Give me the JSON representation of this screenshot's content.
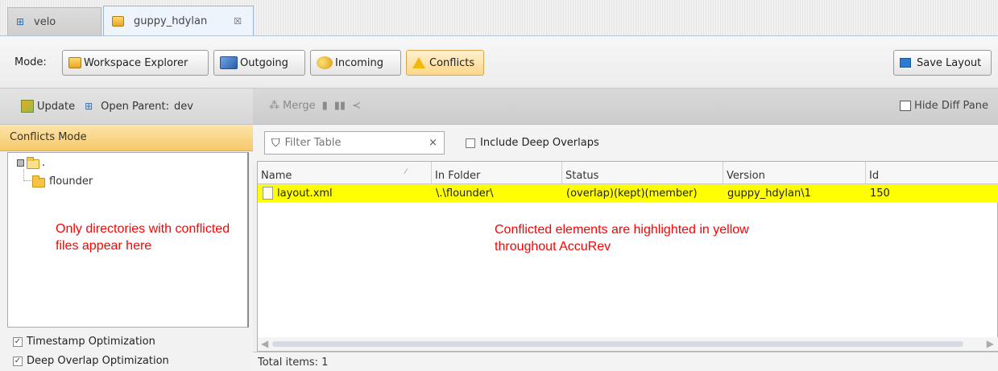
{
  "tabs": [
    {
      "label": "velo",
      "icon": "network-icon"
    },
    {
      "label": "guppy_hdylan",
      "icon": "workspace-icon",
      "close": "☒"
    }
  ],
  "modebar": {
    "mode_label": "Mode:",
    "workspace_explorer": "Workspace Explorer",
    "outgoing": "Outgoing",
    "incoming": "Incoming",
    "conflicts": "Conflicts",
    "save_layout": "Save Layout"
  },
  "left": {
    "update": "Update",
    "open_parent": "Open Parent:",
    "parent_name": "dev",
    "conflicts_mode": "Conflicts Mode",
    "tree": {
      "root": ".",
      "child": "flounder"
    },
    "note": "Only directories with conflicted files appear here",
    "timestamp_opt": "Timestamp Optimization",
    "deep_overlap_opt": "Deep Overlap Optimization"
  },
  "right": {
    "merge": "Merge",
    "hide_diff": "Hide Diff Pane",
    "filter_placeholder": "Filter Table",
    "filter_clear": "×",
    "include_deep": "Include Deep Overlaps",
    "columns": [
      "Name",
      "In Folder",
      "Status",
      "Version",
      "Id"
    ],
    "rows": [
      {
        "name": "layout.xml",
        "folder": "\\.\\flounder\\",
        "status": "(overlap)(kept)(member)",
        "version": "guppy_hdylan\\1",
        "id": "150"
      }
    ],
    "note": "Conflicted elements are highlighted in yellow throughout AccuRev",
    "total": "Total items: 1"
  },
  "colors": {
    "highlight": "#ffff00",
    "annotation": "#ff0000",
    "active_mode": "#fdd68a"
  }
}
